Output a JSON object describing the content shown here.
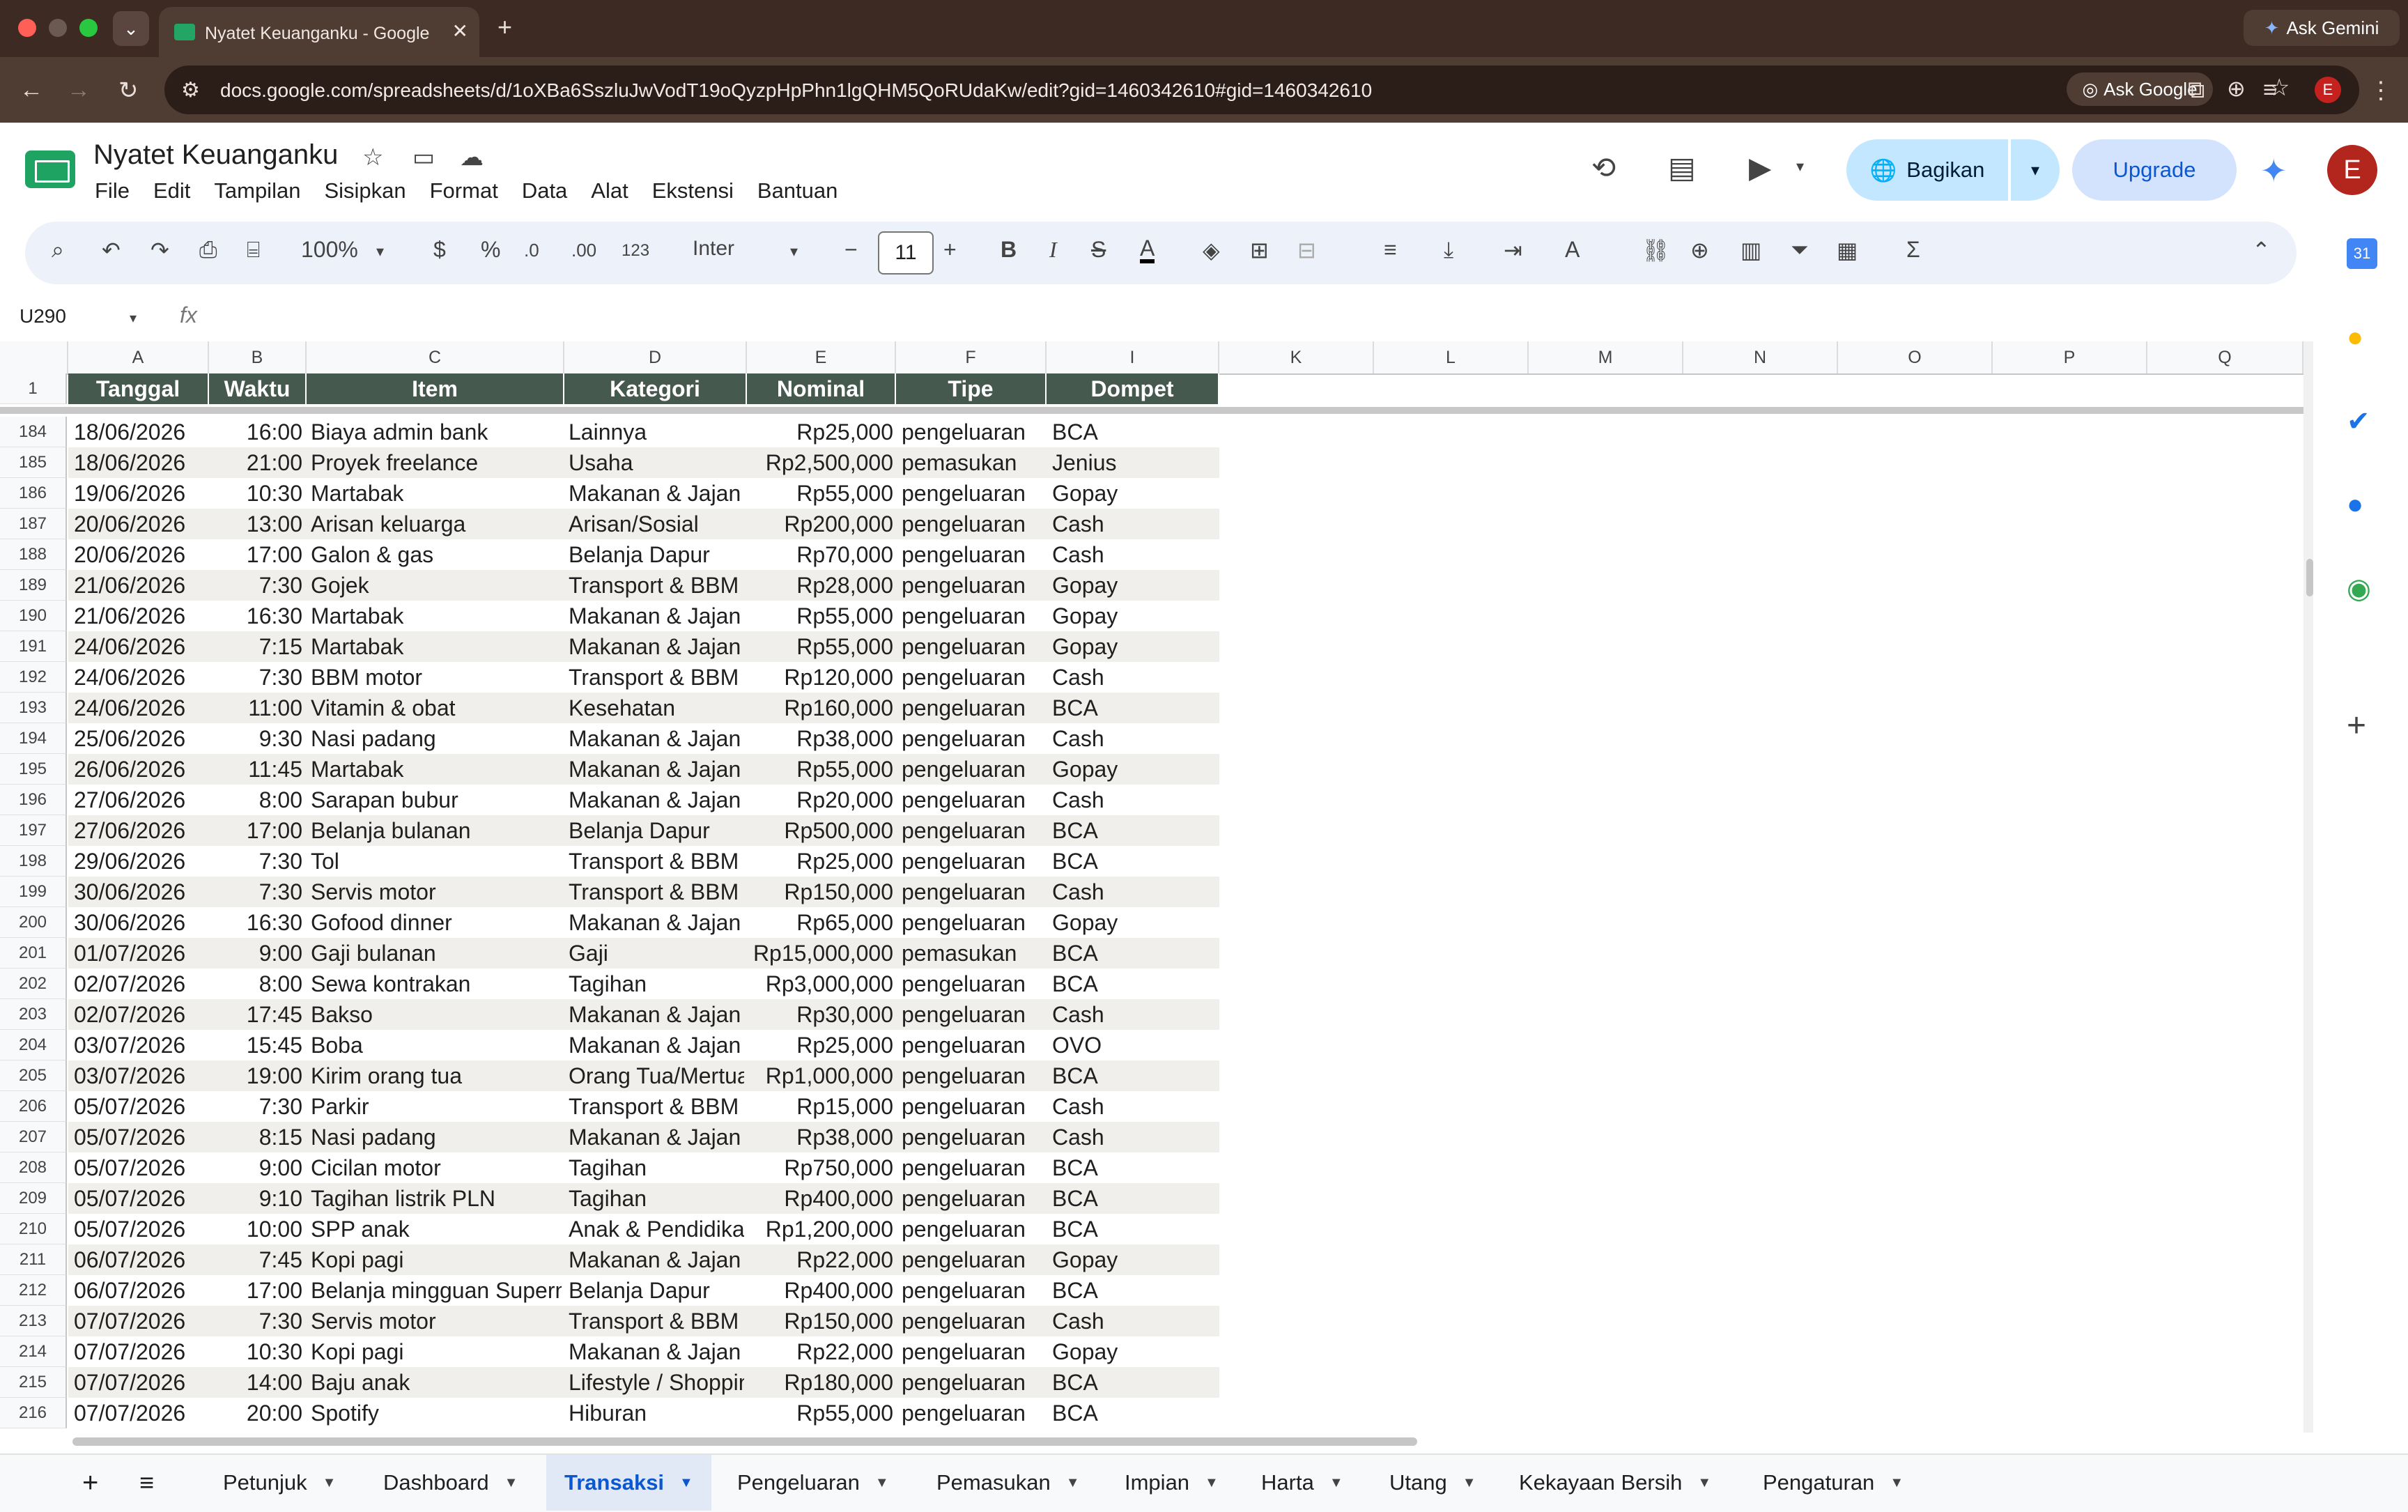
{
  "browser": {
    "tab_title": "Nyatet Keuanganku - Google Sheets",
    "url": "docs.google.com/spreadsheets/d/1oXBa6SszluJwVodT19oQyzpHpPhn1lgQHM5QoRUdaKw/edit?gid=1460342610#gid=1460342610",
    "ask_google_label": "Ask Google",
    "ask_gemini_label": "Ask Gemini",
    "profile_initial": "E"
  },
  "sheet": {
    "title": "Nyatet Keuanganku",
    "menu": [
      "File",
      "Edit",
      "Tampilan",
      "Sisipkan",
      "Format",
      "Data",
      "Alat",
      "Ekstensi",
      "Bantuan"
    ],
    "share_label": "Bagikan",
    "upgrade_label": "Upgrade",
    "avatar_initial": "E"
  },
  "toolbar": {
    "zoom": "100%",
    "currency": "$",
    "percent": "%",
    "dec_decrease": ".0",
    "dec_increase": ".00",
    "number_format": "123",
    "font": "Inter",
    "font_size": "11",
    "bold": "B",
    "italic": "I"
  },
  "formula_bar": {
    "name_box": "U290",
    "fx": "fx",
    "value": ""
  },
  "columns": [
    "A",
    "B",
    "C",
    "D",
    "E",
    "F",
    "I",
    "K",
    "L",
    "M",
    "N",
    "O",
    "P",
    "Q"
  ],
  "headers": [
    "Tanggal",
    "Waktu",
    "Item",
    "Kategori",
    "Nominal",
    "Tipe",
    "Dompet"
  ],
  "header_row_number": "1",
  "rows": [
    {
      "n": "184",
      "tanggal": "18/06/2026",
      "waktu": "16:00",
      "item": "Biaya admin bank",
      "kategori": "Lainnya",
      "nominal": "Rp25,000",
      "tipe": "pengeluaran",
      "dompet": "BCA"
    },
    {
      "n": "185",
      "tanggal": "18/06/2026",
      "waktu": "21:00",
      "item": "Proyek freelance",
      "kategori": "Usaha",
      "nominal": "Rp2,500,000",
      "tipe": "pemasukan",
      "dompet": "Jenius"
    },
    {
      "n": "186",
      "tanggal": "19/06/2026",
      "waktu": "10:30",
      "item": "Martabak",
      "kategori": "Makanan & Jajan",
      "nominal": "Rp55,000",
      "tipe": "pengeluaran",
      "dompet": "Gopay"
    },
    {
      "n": "187",
      "tanggal": "20/06/2026",
      "waktu": "13:00",
      "item": "Arisan keluarga",
      "kategori": "Arisan/Sosial",
      "nominal": "Rp200,000",
      "tipe": "pengeluaran",
      "dompet": "Cash"
    },
    {
      "n": "188",
      "tanggal": "20/06/2026",
      "waktu": "17:00",
      "item": "Galon & gas",
      "kategori": "Belanja Dapur",
      "nominal": "Rp70,000",
      "tipe": "pengeluaran",
      "dompet": "Cash"
    },
    {
      "n": "189",
      "tanggal": "21/06/2026",
      "waktu": "7:30",
      "item": "Gojek",
      "kategori": "Transport & BBM",
      "nominal": "Rp28,000",
      "tipe": "pengeluaran",
      "dompet": "Gopay"
    },
    {
      "n": "190",
      "tanggal": "21/06/2026",
      "waktu": "16:30",
      "item": "Martabak",
      "kategori": "Makanan & Jajan",
      "nominal": "Rp55,000",
      "tipe": "pengeluaran",
      "dompet": "Gopay"
    },
    {
      "n": "191",
      "tanggal": "24/06/2026",
      "waktu": "7:15",
      "item": "Martabak",
      "kategori": "Makanan & Jajan",
      "nominal": "Rp55,000",
      "tipe": "pengeluaran",
      "dompet": "Gopay"
    },
    {
      "n": "192",
      "tanggal": "24/06/2026",
      "waktu": "7:30",
      "item": "BBM motor",
      "kategori": "Transport & BBM",
      "nominal": "Rp120,000",
      "tipe": "pengeluaran",
      "dompet": "Cash"
    },
    {
      "n": "193",
      "tanggal": "24/06/2026",
      "waktu": "11:00",
      "item": "Vitamin & obat",
      "kategori": "Kesehatan",
      "nominal": "Rp160,000",
      "tipe": "pengeluaran",
      "dompet": "BCA"
    },
    {
      "n": "194",
      "tanggal": "25/06/2026",
      "waktu": "9:30",
      "item": "Nasi padang",
      "kategori": "Makanan & Jajan",
      "nominal": "Rp38,000",
      "tipe": "pengeluaran",
      "dompet": "Cash"
    },
    {
      "n": "195",
      "tanggal": "26/06/2026",
      "waktu": "11:45",
      "item": "Martabak",
      "kategori": "Makanan & Jajan",
      "nominal": "Rp55,000",
      "tipe": "pengeluaran",
      "dompet": "Gopay"
    },
    {
      "n": "196",
      "tanggal": "27/06/2026",
      "waktu": "8:00",
      "item": "Sarapan bubur",
      "kategori": "Makanan & Jajan",
      "nominal": "Rp20,000",
      "tipe": "pengeluaran",
      "dompet": "Cash"
    },
    {
      "n": "197",
      "tanggal": "27/06/2026",
      "waktu": "17:00",
      "item": "Belanja bulanan",
      "kategori": "Belanja Dapur",
      "nominal": "Rp500,000",
      "tipe": "pengeluaran",
      "dompet": "BCA"
    },
    {
      "n": "198",
      "tanggal": "29/06/2026",
      "waktu": "7:30",
      "item": "Tol",
      "kategori": "Transport & BBM",
      "nominal": "Rp25,000",
      "tipe": "pengeluaran",
      "dompet": "BCA"
    },
    {
      "n": "199",
      "tanggal": "30/06/2026",
      "waktu": "7:30",
      "item": "Servis motor",
      "kategori": "Transport & BBM",
      "nominal": "Rp150,000",
      "tipe": "pengeluaran",
      "dompet": "Cash"
    },
    {
      "n": "200",
      "tanggal": "30/06/2026",
      "waktu": "16:30",
      "item": "Gofood dinner",
      "kategori": "Makanan & Jajan",
      "nominal": "Rp65,000",
      "tipe": "pengeluaran",
      "dompet": "Gopay"
    },
    {
      "n": "201",
      "tanggal": "01/07/2026",
      "waktu": "9:00",
      "item": "Gaji bulanan",
      "kategori": "Gaji",
      "nominal": "Rp15,000,000",
      "tipe": "pemasukan",
      "dompet": "BCA"
    },
    {
      "n": "202",
      "tanggal": "02/07/2026",
      "waktu": "8:00",
      "item": "Sewa kontrakan",
      "kategori": "Tagihan",
      "nominal": "Rp3,000,000",
      "tipe": "pengeluaran",
      "dompet": "BCA"
    },
    {
      "n": "203",
      "tanggal": "02/07/2026",
      "waktu": "17:45",
      "item": "Bakso",
      "kategori": "Makanan & Jajan",
      "nominal": "Rp30,000",
      "tipe": "pengeluaran",
      "dompet": "Cash"
    },
    {
      "n": "204",
      "tanggal": "03/07/2026",
      "waktu": "15:45",
      "item": "Boba",
      "kategori": "Makanan & Jajan",
      "nominal": "Rp25,000",
      "tipe": "pengeluaran",
      "dompet": "OVO"
    },
    {
      "n": "205",
      "tanggal": "03/07/2026",
      "waktu": "19:00",
      "item": "Kirim orang tua",
      "kategori": "Orang Tua/Mertua",
      "nominal": "Rp1,000,000",
      "tipe": "pengeluaran",
      "dompet": "BCA"
    },
    {
      "n": "206",
      "tanggal": "05/07/2026",
      "waktu": "7:30",
      "item": "Parkir",
      "kategori": "Transport & BBM",
      "nominal": "Rp15,000",
      "tipe": "pengeluaran",
      "dompet": "Cash"
    },
    {
      "n": "207",
      "tanggal": "05/07/2026",
      "waktu": "8:15",
      "item": "Nasi padang",
      "kategori": "Makanan & Jajan",
      "nominal": "Rp38,000",
      "tipe": "pengeluaran",
      "dompet": "Cash"
    },
    {
      "n": "208",
      "tanggal": "05/07/2026",
      "waktu": "9:00",
      "item": "Cicilan motor",
      "kategori": "Tagihan",
      "nominal": "Rp750,000",
      "tipe": "pengeluaran",
      "dompet": "BCA"
    },
    {
      "n": "209",
      "tanggal": "05/07/2026",
      "waktu": "9:10",
      "item": "Tagihan listrik PLN",
      "kategori": "Tagihan",
      "nominal": "Rp400,000",
      "tipe": "pengeluaran",
      "dompet": "BCA"
    },
    {
      "n": "210",
      "tanggal": "05/07/2026",
      "waktu": "10:00",
      "item": "SPP anak",
      "kategori": "Anak & Pendidikan",
      "nominal": "Rp1,200,000",
      "tipe": "pengeluaran",
      "dompet": "BCA"
    },
    {
      "n": "211",
      "tanggal": "06/07/2026",
      "waktu": "7:45",
      "item": "Kopi pagi",
      "kategori": "Makanan & Jajan",
      "nominal": "Rp22,000",
      "tipe": "pengeluaran",
      "dompet": "Gopay"
    },
    {
      "n": "212",
      "tanggal": "06/07/2026",
      "waktu": "17:00",
      "item": "Belanja mingguan Supermarket",
      "kategori": "Belanja Dapur",
      "nominal": "Rp400,000",
      "tipe": "pengeluaran",
      "dompet": "BCA"
    },
    {
      "n": "213",
      "tanggal": "07/07/2026",
      "waktu": "7:30",
      "item": "Servis motor",
      "kategori": "Transport & BBM",
      "nominal": "Rp150,000",
      "tipe": "pengeluaran",
      "dompet": "Cash"
    },
    {
      "n": "214",
      "tanggal": "07/07/2026",
      "waktu": "10:30",
      "item": "Kopi pagi",
      "kategori": "Makanan & Jajan",
      "nominal": "Rp22,000",
      "tipe": "pengeluaran",
      "dompet": "Gopay"
    },
    {
      "n": "215",
      "tanggal": "07/07/2026",
      "waktu": "14:00",
      "item": "Baju anak",
      "kategori": "Lifestyle / Shopping",
      "nominal": "Rp180,000",
      "tipe": "pengeluaran",
      "dompet": "BCA"
    },
    {
      "n": "216",
      "tanggal": "07/07/2026",
      "waktu": "20:00",
      "item": "Spotify",
      "kategori": "Hiburan",
      "nominal": "Rp55,000",
      "tipe": "pengeluaran",
      "dompet": "BCA"
    }
  ],
  "sheet_tabs": [
    "Petunjuk",
    "Dashboard",
    "Transaksi",
    "Pengeluaran",
    "Pemasukan",
    "Impian",
    "Harta",
    "Utang",
    "Kekayaan Bersih",
    "Pengaturan"
  ],
  "active_tab": "Transaksi",
  "colors": {
    "header_bg": "#46594f",
    "alt_row": "#f1efec",
    "accent": "#0b57d0",
    "browser_frame": "#3c2a23"
  }
}
